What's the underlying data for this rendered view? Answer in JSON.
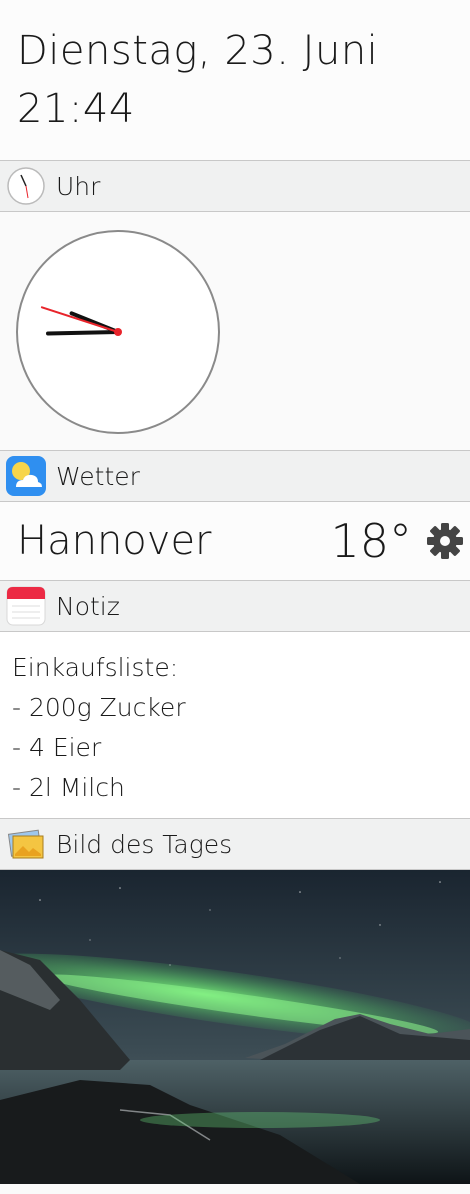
{
  "datetime": {
    "date": "Dienstag, 23. Juni",
    "time": "21:44"
  },
  "clock": {
    "title": "Uhr",
    "hour": 21,
    "minute": 44,
    "second": 48
  },
  "weather": {
    "title": "Wetter",
    "city": "Hannover",
    "temperature": "18°"
  },
  "note": {
    "title": "Notiz",
    "lines": [
      "Einkaufsliste:",
      "- 200g Zucker",
      "- 4 Eier",
      "- 2l Milch"
    ]
  },
  "photo": {
    "title": "Bild des Tages"
  },
  "icons": {
    "clock": "clock-icon",
    "weather": "weather-icon",
    "note": "notepad-icon",
    "photo": "picture-icon",
    "settings": "gear-icon"
  },
  "colors": {
    "second_hand": "#e8242b",
    "weather_icon_bg": "#2f8ff0",
    "note_icon_top": "#ec2a44"
  }
}
